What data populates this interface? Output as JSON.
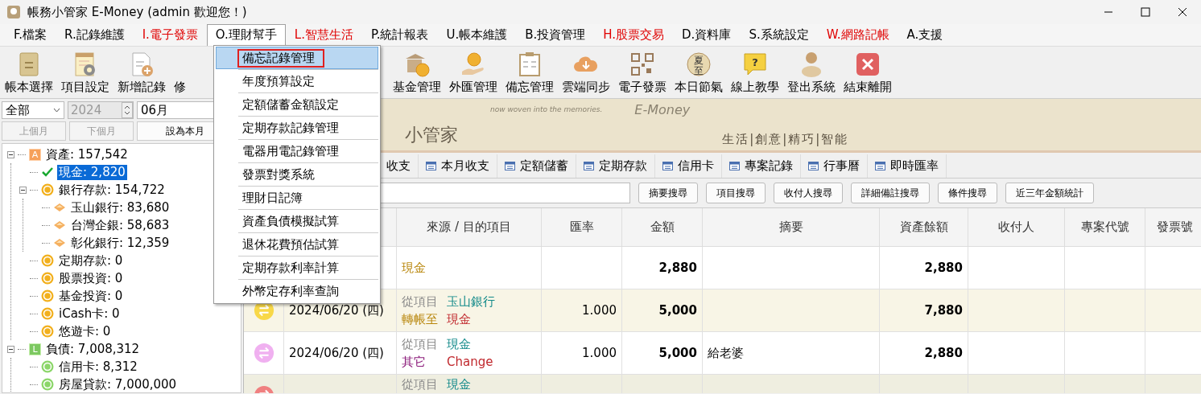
{
  "window": {
    "title": "帳務小管家 E-Money (admin 歡迎您！)"
  },
  "menu_bar": [
    {
      "label": "F.檔案",
      "color": "#000000",
      "selected": false
    },
    {
      "label": "R.記錄維護",
      "color": "#000000",
      "selected": false
    },
    {
      "label": "I.電子發票",
      "color": "#e00000",
      "selected": false
    },
    {
      "label": "O.理財幫手",
      "color": "#000000",
      "selected": true
    },
    {
      "label": "L.智慧生活",
      "color": "#e00000",
      "selected": false
    },
    {
      "label": "P.統計報表",
      "color": "#000000",
      "selected": false
    },
    {
      "label": "U.帳本維護",
      "color": "#000000",
      "selected": false
    },
    {
      "label": "B.投資管理",
      "color": "#000000",
      "selected": false
    },
    {
      "label": "H.股票交易",
      "color": "#e00000",
      "selected": false
    },
    {
      "label": "D.資料庫",
      "color": "#000000",
      "selected": false
    },
    {
      "label": "S.系統設定",
      "color": "#000000",
      "selected": false
    },
    {
      "label": "W.網路記帳",
      "color": "#e00000",
      "selected": false
    },
    {
      "label": "A.支援",
      "color": "#000000",
      "selected": false
    }
  ],
  "dropdown_menu": [
    {
      "label": "備忘記錄管理",
      "selected": true,
      "highlighted": true
    },
    {
      "label": "年度預算設定",
      "selected": false,
      "highlighted": false
    },
    {
      "label": "定額儲蓄金額設定",
      "selected": false,
      "highlighted": false
    },
    {
      "label": "定期存款記錄管理",
      "selected": false,
      "highlighted": false
    },
    {
      "label": "電器用電記錄管理",
      "selected": false,
      "highlighted": false
    },
    {
      "label": "發票對獎系統",
      "selected": false,
      "highlighted": false
    },
    {
      "label": "理財日記簿",
      "selected": false,
      "highlighted": false
    },
    {
      "label": "資產負債模擬試算",
      "selected": false,
      "highlighted": false
    },
    {
      "label": "退休花費預估試算",
      "selected": false,
      "highlighted": false
    },
    {
      "label": "定期存款利率計算",
      "selected": false,
      "highlighted": false
    },
    {
      "label": "外幣定存利率查詢",
      "selected": false,
      "highlighted": false
    }
  ],
  "toolbar": {
    "left": [
      {
        "label": "帳本選擇",
        "kind": "ledger"
      },
      {
        "label": "項目設定",
        "kind": "notepad"
      },
      {
        "label": "新增記錄",
        "kind": "add"
      },
      {
        "label": "修",
        "kind": "covered"
      }
    ],
    "right": [
      {
        "label": "基金管理",
        "kind": "bank"
      },
      {
        "label": "外匯管理",
        "kind": "hand"
      },
      {
        "label": "備忘管理",
        "kind": "clipboard"
      },
      {
        "label": "雲端同步",
        "kind": "cloud"
      },
      {
        "label": "電子發票",
        "kind": "qr"
      },
      {
        "label": "本日節氣",
        "kind": "solar",
        "badge": "夏至"
      },
      {
        "label": "線上教學",
        "kind": "help",
        "badge": "?"
      },
      {
        "label": "登出系統",
        "kind": "user"
      },
      {
        "label": "結束離開",
        "kind": "exit"
      }
    ]
  },
  "filter": {
    "category": "全部",
    "year": {
      "value": "2024",
      "disabled": true
    },
    "month": "06月",
    "buttons": [
      {
        "label": "上個月",
        "disabled": true
      },
      {
        "label": "下個月",
        "disabled": true
      },
      {
        "label": "設為本月",
        "disabled": false
      }
    ]
  },
  "tree": [
    {
      "label": "資產: 157,542",
      "kind": "asset",
      "badge": "A",
      "selected": false,
      "expanded": true,
      "children": [
        {
          "label": "現金: 2,820",
          "kind": "check",
          "selected": true
        },
        {
          "label": "銀行存款: 154,722",
          "kind": "coin",
          "selected": false,
          "expanded": true,
          "children": [
            {
              "label": "玉山銀行: 83,680",
              "kind": "tag",
              "selected": false
            },
            {
              "label": "台灣企銀: 58,683",
              "kind": "tag",
              "selected": false
            },
            {
              "label": "彰化銀行: 12,359",
              "kind": "tag",
              "selected": false
            }
          ]
        },
        {
          "label": "定期存款: 0",
          "kind": "coin",
          "selected": false
        },
        {
          "label": "股票投資: 0",
          "kind": "coin",
          "selected": false
        },
        {
          "label": "基金投資: 0",
          "kind": "coin",
          "selected": false
        },
        {
          "label": "iCash卡: 0",
          "kind": "coin",
          "selected": false
        },
        {
          "label": "悠遊卡: 0",
          "kind": "coin",
          "selected": false
        }
      ]
    },
    {
      "label": "負債: 7,008,312",
      "kind": "liability",
      "badge": "L",
      "selected": false,
      "expanded": true,
      "children": [
        {
          "label": "信用卡: 8,312",
          "kind": "coin-green",
          "selected": false
        },
        {
          "label": "房屋貸款: 7,000,000",
          "kind": "coin-green",
          "selected": false
        }
      ]
    }
  ],
  "banner": {
    "tagline": "now woven into the memories.",
    "brand": "E-Money",
    "name": "小管家",
    "motto": "生活|創意|精巧|智能"
  },
  "tabs": [
    {
      "label": "收支"
    },
    {
      "label": "本月收支"
    },
    {
      "label": "定額儲蓄"
    },
    {
      "label": "定期存款"
    },
    {
      "label": "信用卡"
    },
    {
      "label": "專案記錄"
    },
    {
      "label": "行事曆"
    },
    {
      "label": "即時匯率"
    }
  ],
  "search": {
    "buttons": [
      "摘要搜尋",
      "項目搜尋",
      "收付人搜尋",
      "詳細備註搜尋",
      "條件搜尋",
      "近三年金額統計"
    ]
  },
  "table": {
    "columns": [
      "來源 / 目的項目",
      "匯率",
      "金額",
      "摘要",
      "資產餘額",
      "收付人",
      "專案代號",
      "發票號"
    ],
    "rows": [
      {
        "source": [
          {
            "kind": "account",
            "item": "現金"
          }
        ],
        "amount": "2,880",
        "balance": "2,880"
      },
      {
        "kind": "transfer",
        "date": "2024/06/20 (四)",
        "source": [
          {
            "kind": "from",
            "label": "從項目",
            "item": "玉山銀行"
          },
          {
            "kind": "to",
            "label": "轉帳至",
            "item": "現金"
          }
        ],
        "rate": "1.000",
        "amount": "5,000",
        "balance": "7,880"
      },
      {
        "kind": "exchange",
        "date": "2024/06/20 (四)",
        "source": [
          {
            "kind": "from",
            "label": "從項目",
            "item": "現金"
          },
          {
            "kind": "other",
            "label": "其它",
            "item": "Change"
          }
        ],
        "rate": "1.000",
        "amount": "5,000",
        "summary": "給老婆",
        "balance": "2,880"
      },
      {
        "kind": "expense",
        "source": [
          {
            "kind": "from",
            "label": "從項目",
            "item": "現金"
          }
        ]
      }
    ]
  }
}
